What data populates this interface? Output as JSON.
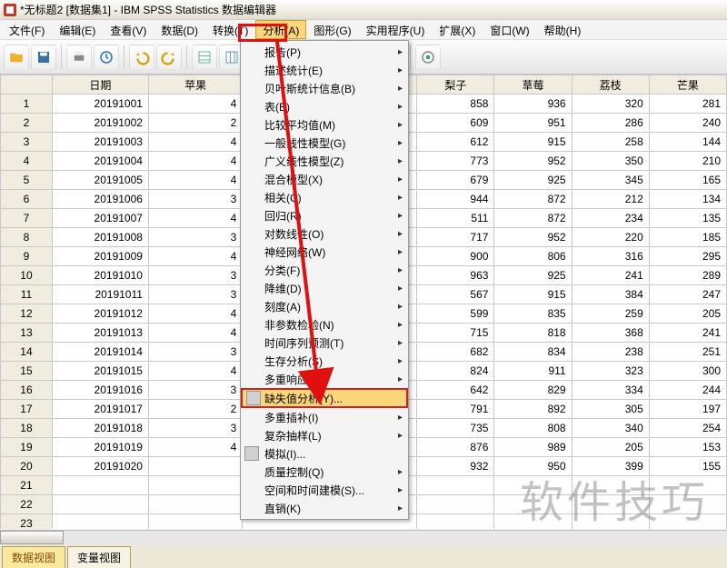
{
  "title": "*无标题2 [数据集1] - IBM SPSS Statistics 数据编辑器",
  "menubar": [
    "文件(F)",
    "编辑(E)",
    "查看(V)",
    "数据(D)",
    "转换(T)",
    "分析(A)",
    "图形(G)",
    "实用程序(U)",
    "扩展(X)",
    "窗口(W)",
    "帮助(H)"
  ],
  "menubar_active_index": 5,
  "columns": {
    "row": "",
    "date": "日期",
    "apple": "苹果",
    "blank": "",
    "pear": "梨子",
    "strawberry": "草莓",
    "lychee": "荔枝",
    "mango": "芒果"
  },
  "rows": [
    {
      "n": 1,
      "date": "20191001",
      "a": "4",
      "b": 858,
      "c": 936,
      "d": 320,
      "e": 281
    },
    {
      "n": 2,
      "date": "20191002",
      "a": "2",
      "b": 609,
      "c": 951,
      "d": 286,
      "e": 240
    },
    {
      "n": 3,
      "date": "20191003",
      "a": "4",
      "b": 612,
      "c": 915,
      "d": 258,
      "e": 144
    },
    {
      "n": 4,
      "date": "20191004",
      "a": "4",
      "b": 773,
      "c": 952,
      "d": 350,
      "e": 210
    },
    {
      "n": 5,
      "date": "20191005",
      "a": "4",
      "b": 679,
      "c": 925,
      "d": 345,
      "e": 165
    },
    {
      "n": 6,
      "date": "20191006",
      "a": "3",
      "b": 944,
      "c": 872,
      "d": 212,
      "e": 134
    },
    {
      "n": 7,
      "date": "20191007",
      "a": "4",
      "b": 511,
      "c": 872,
      "d": 234,
      "e": 135
    },
    {
      "n": 8,
      "date": "20191008",
      "a": "3",
      "b": 717,
      "c": 952,
      "d": 220,
      "e": 185
    },
    {
      "n": 9,
      "date": "20191009",
      "a": "4",
      "b": 900,
      "c": 806,
      "d": 316,
      "e": 295
    },
    {
      "n": 10,
      "date": "20191010",
      "a": "3",
      "b": 963,
      "c": 925,
      "d": 241,
      "e": 289
    },
    {
      "n": 11,
      "date": "20191011",
      "a": "3",
      "b": 567,
      "c": 915,
      "d": 384,
      "e": 247
    },
    {
      "n": 12,
      "date": "20191012",
      "a": "4",
      "b": 599,
      "c": 835,
      "d": 259,
      "e": 205
    },
    {
      "n": 13,
      "date": "20191013",
      "a": "4",
      "b": 715,
      "c": 818,
      "d": 368,
      "e": 241
    },
    {
      "n": 14,
      "date": "20191014",
      "a": "3",
      "b": 682,
      "c": 834,
      "d": 238,
      "e": 251
    },
    {
      "n": 15,
      "date": "20191015",
      "a": "4",
      "b": 824,
      "c": 911,
      "d": 323,
      "e": 300
    },
    {
      "n": 16,
      "date": "20191016",
      "a": "3",
      "b": 642,
      "c": 829,
      "d": 334,
      "e": 244
    },
    {
      "n": 17,
      "date": "20191017",
      "a": "2",
      "b": 791,
      "c": 892,
      "d": 305,
      "e": 197
    },
    {
      "n": 18,
      "date": "20191018",
      "a": "3",
      "b": 735,
      "c": 808,
      "d": 340,
      "e": 254
    },
    {
      "n": 19,
      "date": "20191019",
      "a": "4",
      "b": 876,
      "c": 989,
      "d": 205,
      "e": 153
    },
    {
      "n": 20,
      "date": "20191020",
      "a": "",
      "b": 932,
      "c": 950,
      "d": 399,
      "e": 155
    },
    {
      "n": 21,
      "date": "",
      "a": "",
      "b": "",
      "c": "",
      "d": "",
      "e": ""
    },
    {
      "n": 22,
      "date": "",
      "a": "",
      "b": "",
      "c": "",
      "d": "",
      "e": ""
    },
    {
      "n": 23,
      "date": "",
      "a": "",
      "b": "",
      "c": "",
      "d": "",
      "e": ""
    }
  ],
  "dropdown": [
    {
      "label": "报告(P)",
      "sub": true
    },
    {
      "label": "描述统计(E)",
      "sub": true
    },
    {
      "label": "贝叶斯统计信息(B)",
      "sub": true
    },
    {
      "label": "表(B)",
      "sub": true
    },
    {
      "label": "比较平均值(M)",
      "sub": true
    },
    {
      "label": "一般线性模型(G)",
      "sub": true
    },
    {
      "label": "广义线性模型(Z)",
      "sub": true
    },
    {
      "label": "混合模型(X)",
      "sub": true
    },
    {
      "label": "相关(C)",
      "sub": true
    },
    {
      "label": "回归(R)",
      "sub": true
    },
    {
      "label": "对数线性(O)",
      "sub": true
    },
    {
      "label": "神经网络(W)",
      "sub": true
    },
    {
      "label": "分类(F)",
      "sub": true
    },
    {
      "label": "降维(D)",
      "sub": true
    },
    {
      "label": "刻度(A)",
      "sub": true
    },
    {
      "label": "非参数检验(N)",
      "sub": true
    },
    {
      "label": "时间序列预测(T)",
      "sub": true
    },
    {
      "label": "生存分析(S)",
      "sub": true
    },
    {
      "label": "多重响应(U)",
      "sub": true
    },
    {
      "label": "缺失值分析(Y)...",
      "sub": false,
      "icon": true,
      "highlight": true
    },
    {
      "label": "多重插补(I)",
      "sub": true
    },
    {
      "label": "复杂抽样(L)",
      "sub": true
    },
    {
      "label": "模拟(I)...",
      "sub": false,
      "icon": true
    },
    {
      "label": "质量控制(Q)",
      "sub": true
    },
    {
      "label": "空间和时间建模(S)...",
      "sub": true
    },
    {
      "label": "直销(K)",
      "sub": true
    }
  ],
  "tabs": {
    "data": "数据视图",
    "var": "变量视图"
  },
  "watermark": "软件技巧"
}
